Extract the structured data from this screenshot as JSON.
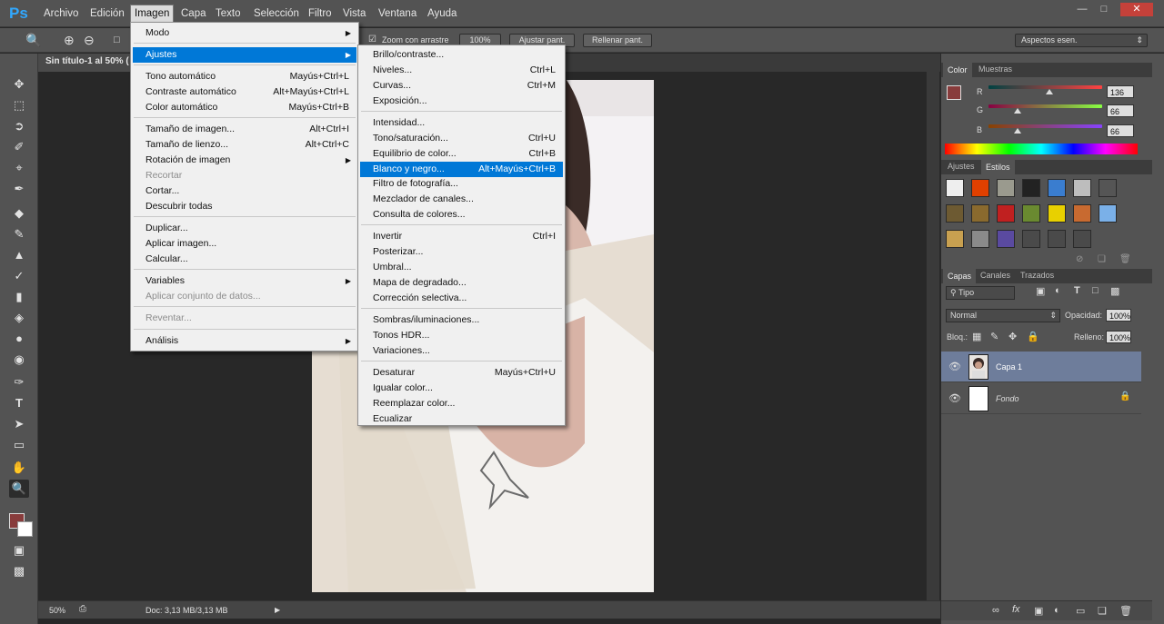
{
  "app": {
    "logo": "Ps",
    "menus": [
      "Archivo",
      "Edición",
      "Imagen",
      "Capa",
      "Texto",
      "Selección",
      "Filtro",
      "Vista",
      "Ventana",
      "Ayuda"
    ],
    "active_menu": "Imagen"
  },
  "options_bar": {
    "zoom_drag_label": "Zoom con arrastre",
    "btn_100": "100%",
    "btn_fit": "Ajustar pant.",
    "btn_fill": "Rellenar pant.",
    "workspace": "Aspectos esen."
  },
  "document": {
    "tab_title": "Sin título-1 al 50% (",
    "zoom": "50%",
    "doc_info": "Doc: 3,13 MB/3,13 MB"
  },
  "imagen_menu": {
    "items": [
      {
        "label": "Modo",
        "shortcut": "",
        "submenu": true
      },
      {
        "label": "Ajustes",
        "shortcut": "",
        "submenu": true,
        "highlight": true
      },
      {
        "label": "Tono automático",
        "shortcut": "Mayús+Ctrl+L"
      },
      {
        "label": "Contraste automático",
        "shortcut": "Alt+Mayús+Ctrl+L"
      },
      {
        "label": "Color automático",
        "shortcut": "Mayús+Ctrl+B"
      },
      {
        "label": "Tamaño de imagen...",
        "shortcut": "Alt+Ctrl+I"
      },
      {
        "label": "Tamaño de lienzo...",
        "shortcut": "Alt+Ctrl+C"
      },
      {
        "label": "Rotación de imagen",
        "shortcut": "",
        "submenu": true
      },
      {
        "label": "Recortar",
        "shortcut": "",
        "disabled": true
      },
      {
        "label": "Cortar...",
        "shortcut": ""
      },
      {
        "label": "Descubrir todas",
        "shortcut": ""
      },
      {
        "label": "Duplicar...",
        "shortcut": ""
      },
      {
        "label": "Aplicar imagen...",
        "shortcut": ""
      },
      {
        "label": "Calcular...",
        "shortcut": ""
      },
      {
        "label": "Variables",
        "shortcut": "",
        "submenu": true
      },
      {
        "label": "Aplicar conjunto de datos...",
        "shortcut": "",
        "disabled": true
      },
      {
        "label": "Reventar...",
        "shortcut": "",
        "disabled": true
      },
      {
        "label": "Análisis",
        "shortcut": "",
        "submenu": true
      }
    ]
  },
  "ajustes_menu": {
    "items": [
      {
        "label": "Brillo/contraste...",
        "shortcut": ""
      },
      {
        "label": "Niveles...",
        "shortcut": "Ctrl+L"
      },
      {
        "label": "Curvas...",
        "shortcut": "Ctrl+M"
      },
      {
        "label": "Exposición...",
        "shortcut": ""
      },
      {
        "label": "Intensidad...",
        "shortcut": ""
      },
      {
        "label": "Tono/saturación...",
        "shortcut": "Ctrl+U"
      },
      {
        "label": "Equilibrio de color...",
        "shortcut": "Ctrl+B"
      },
      {
        "label": "Blanco y negro...",
        "shortcut": "Alt+Mayús+Ctrl+B",
        "highlight": true
      },
      {
        "label": "Filtro de fotografía...",
        "shortcut": ""
      },
      {
        "label": "Mezclador de canales...",
        "shortcut": ""
      },
      {
        "label": "Consulta de colores...",
        "shortcut": ""
      },
      {
        "label": "Invertir",
        "shortcut": "Ctrl+I"
      },
      {
        "label": "Posterizar...",
        "shortcut": ""
      },
      {
        "label": "Umbral...",
        "shortcut": ""
      },
      {
        "label": "Mapa de degradado...",
        "shortcut": ""
      },
      {
        "label": "Corrección selectiva...",
        "shortcut": ""
      },
      {
        "label": "Sombras/iluminaciones...",
        "shortcut": ""
      },
      {
        "label": "Tonos HDR...",
        "shortcut": ""
      },
      {
        "label": "Variaciones...",
        "shortcut": ""
      },
      {
        "label": "Desaturar",
        "shortcut": "Mayús+Ctrl+U"
      },
      {
        "label": "Igualar color...",
        "shortcut": ""
      },
      {
        "label": "Reemplazar color...",
        "shortcut": ""
      },
      {
        "label": "Ecualizar",
        "shortcut": ""
      }
    ]
  },
  "color_panel": {
    "tabs": [
      "Color",
      "Muestras"
    ],
    "r_label": "R",
    "g_label": "G",
    "b_label": "B",
    "r": "136",
    "g": "66",
    "b": "66",
    "fg_color": "#883c3c"
  },
  "styles_panel": {
    "tabs": [
      "Ajustes",
      "Estilos"
    ]
  },
  "layers_panel": {
    "tabs": [
      "Capas",
      "Canales",
      "Trazados"
    ],
    "filter": "Tipo",
    "blend_mode": "Normal",
    "opacity_label": "Opacidad:",
    "opacity": "100%",
    "lock_label": "Bloq.:",
    "fill_label": "Relleno:",
    "fill": "100%",
    "layers": [
      {
        "name": "Capa 1",
        "selected": true
      },
      {
        "name": "Fondo",
        "locked": true
      }
    ]
  }
}
